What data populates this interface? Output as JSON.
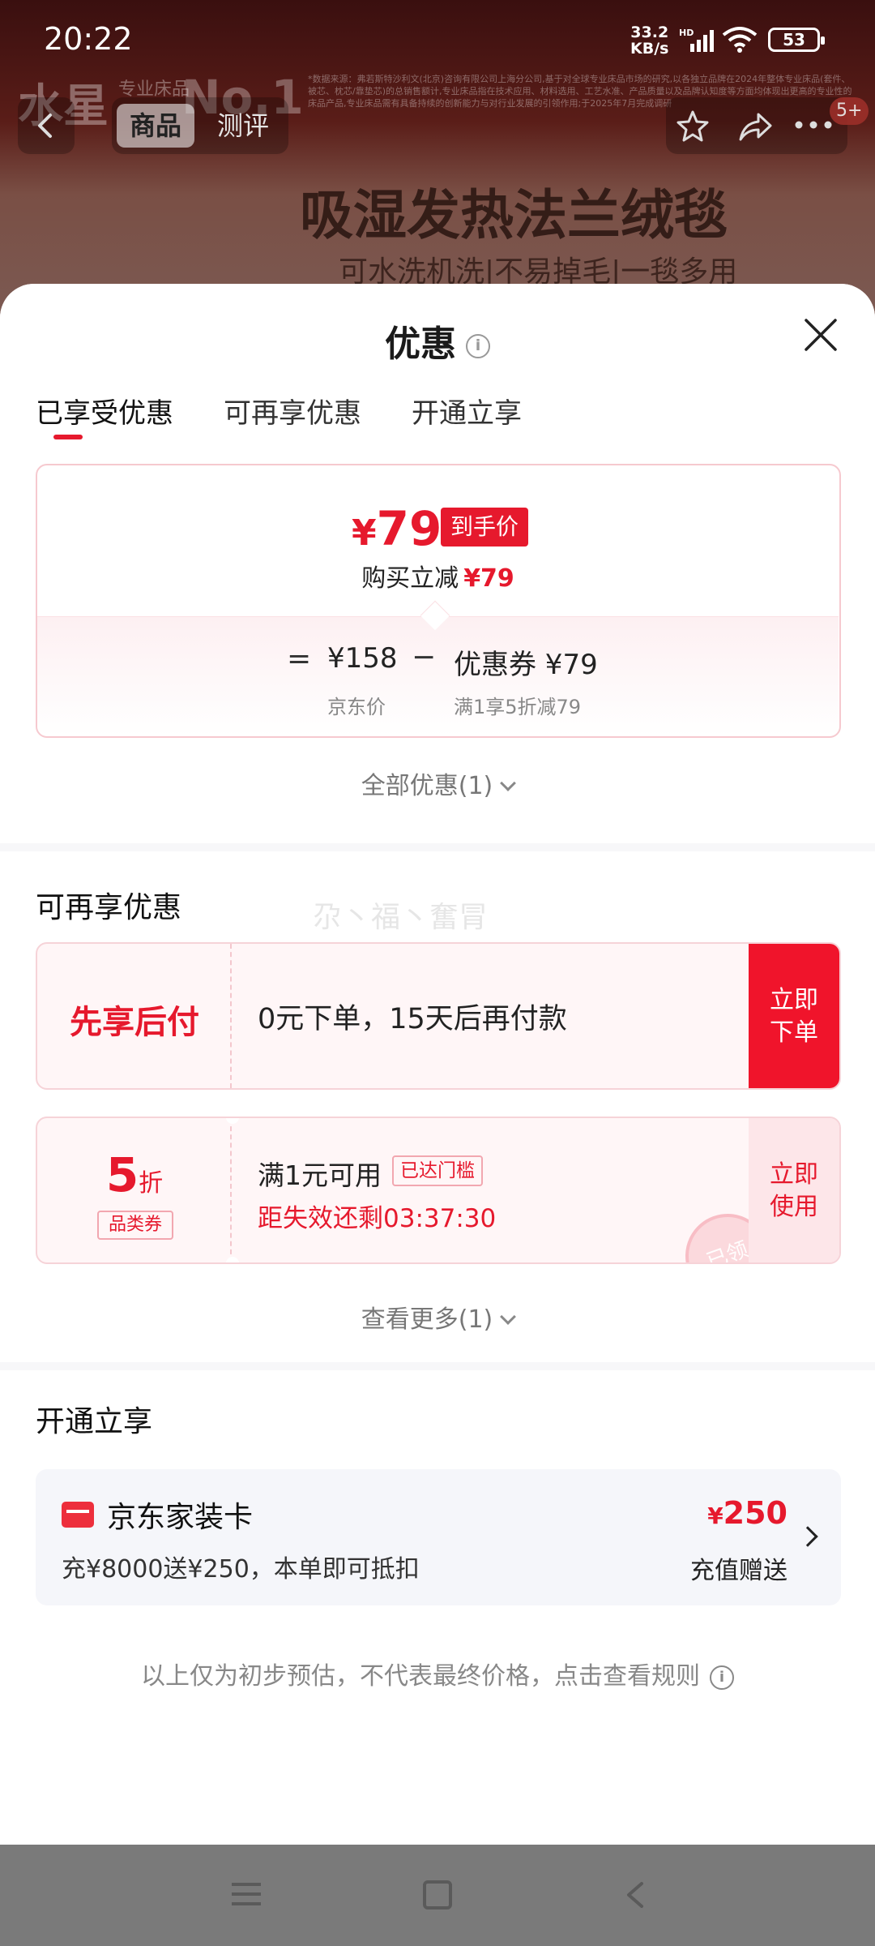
{
  "status_bar": {
    "time": "20:22",
    "net_speed": "33.2",
    "net_unit": "KB/s",
    "net_type": "HD",
    "battery": "53"
  },
  "background": {
    "brand": "水星",
    "brand_small": "专业床品",
    "brand_rank": "No.1",
    "fine_print": "*数据来源：弗若斯特沙利文(北京)咨询有限公司上海分公司,基于对全球专业床品市场的研究,以各独立品牌在2024年整体专业床品(套件、被芯、枕芯/靠垫芯)的总销售额计,专业床品指在技术应用、材料选用、工艺水准、产品质量以及品牌认知度等方面均体现出更高的专业性的床品产品,专业床品需有具备持续的创新能力与对行业发展的引领作用;于2025年7月完成调研",
    "nav_tabs": [
      "商品",
      "测评"
    ],
    "badge": "5+",
    "hero_title": "吸湿发热法兰绒毯",
    "hero_subtitle": "可水洗机洗|不易掉毛|一毯多用"
  },
  "sheet": {
    "title": "优惠",
    "tabs": [
      "已享受优惠",
      "可再享优惠",
      "开通立享"
    ],
    "enjoyed": {
      "final_price_symbol": "¥",
      "final_price": "79",
      "price_tag": "到手价",
      "reduce_label": "购买立减",
      "reduce_value": "¥79",
      "equals": "=",
      "jd_price": "¥158",
      "jd_price_label": "京东价",
      "minus": "−",
      "coupon_text": "优惠券 ¥79",
      "coupon_rule": "满1享5折减79"
    },
    "all_offers": "全部优惠(1)",
    "more_section": {
      "title": "可再享优惠",
      "watermark": "尕丶福丶奮冐",
      "paylater": {
        "title": "先享后付",
        "desc": "0元下单，15天后再付款",
        "cta_line1": "立即",
        "cta_line2": "下单"
      },
      "coupon": {
        "value": "5",
        "unit": "折",
        "type": "品类券",
        "condition": "满1元可用",
        "threshold_tag": "已达门槛",
        "countdown": "距失效还剩03:37:30",
        "cta_line1": "立即",
        "cta_line2": "使用",
        "stamp": "已领"
      },
      "see_more": "查看更多(1)"
    },
    "open_section": {
      "title": "开通立享",
      "card": {
        "name": "京东家装卡",
        "desc": "充¥8000送¥250，本单即可抵扣",
        "amount_symbol": "¥",
        "amount": "250",
        "label": "充值赠送"
      }
    },
    "disclaimer": "以上仅为初步预估，不代表最终价格，点击查看规则"
  },
  "colors": {
    "accent_red": "#e6192d",
    "sheet_bg": "#f7f7f9",
    "nav_bar": "#7a7a7a"
  },
  "icons": [
    "back-icon",
    "star-icon",
    "share-icon",
    "more-icon",
    "info-icon",
    "close-icon",
    "chevron-down-icon",
    "card-icon",
    "chevron-right-icon",
    "menu-icon",
    "home-icon"
  ]
}
